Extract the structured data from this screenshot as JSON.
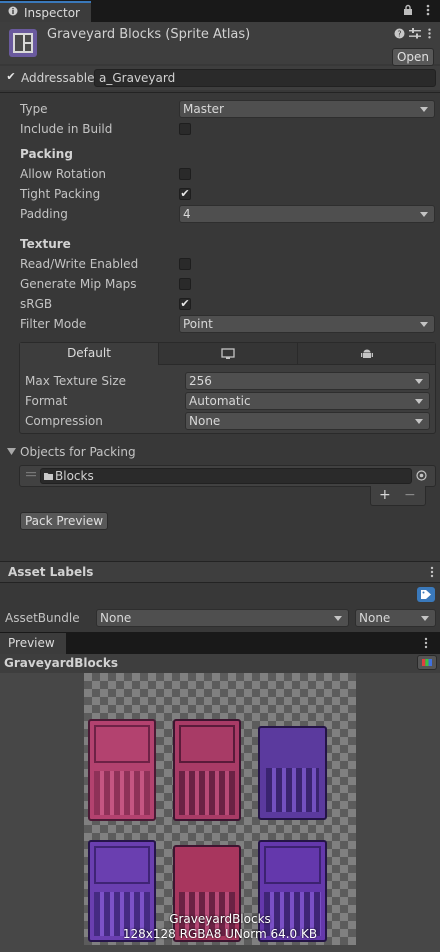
{
  "tab": {
    "label": "Inspector"
  },
  "asset": {
    "title": "Graveyard Blocks (Sprite Atlas)",
    "open_label": "Open"
  },
  "addressable": {
    "label": "Addressable",
    "checked": true,
    "value": "a_Graveyard"
  },
  "fields": {
    "type": {
      "label": "Type",
      "value": "Master"
    },
    "include_in_build": {
      "label": "Include in Build",
      "checked": false
    },
    "packing_header": "Packing",
    "allow_rotation": {
      "label": "Allow Rotation",
      "checked": false
    },
    "tight_packing": {
      "label": "Tight Packing",
      "checked": true
    },
    "padding": {
      "label": "Padding",
      "value": "4"
    },
    "texture_header": "Texture",
    "read_write": {
      "label": "Read/Write Enabled",
      "checked": false
    },
    "generate_mip": {
      "label": "Generate Mip Maps",
      "checked": false
    },
    "srgb": {
      "label": "sRGB",
      "checked": true
    },
    "filter_mode": {
      "label": "Filter Mode",
      "value": "Point"
    }
  },
  "platform": {
    "tabs": [
      "Default",
      "monitor-icon",
      "android-icon"
    ],
    "max_texture_size": {
      "label": "Max Texture Size",
      "value": "256"
    },
    "format": {
      "label": "Format",
      "value": "Automatic"
    },
    "compression": {
      "label": "Compression",
      "value": "None"
    }
  },
  "objects": {
    "header": "Objects for Packing",
    "items": [
      {
        "value": "Blocks"
      }
    ],
    "add_label": "+",
    "remove_label": "−"
  },
  "pack_preview_label": "Pack Preview",
  "asset_labels": {
    "header": "Asset Labels",
    "assetbundle_label": "AssetBundle",
    "bundle_value": "None",
    "variant_value": "None"
  },
  "preview": {
    "tab_label": "Preview",
    "asset_name": "GraveyardBlocks",
    "overlay_name": "GraveyardBlocks",
    "overlay_info": "128x128 RGBA8 UNorm  64.0 KB"
  },
  "colors": {
    "accent": "#3a79bb",
    "panel": "#383838",
    "pink_block": "#b3426f",
    "purple_block": "#6a3fb0"
  }
}
